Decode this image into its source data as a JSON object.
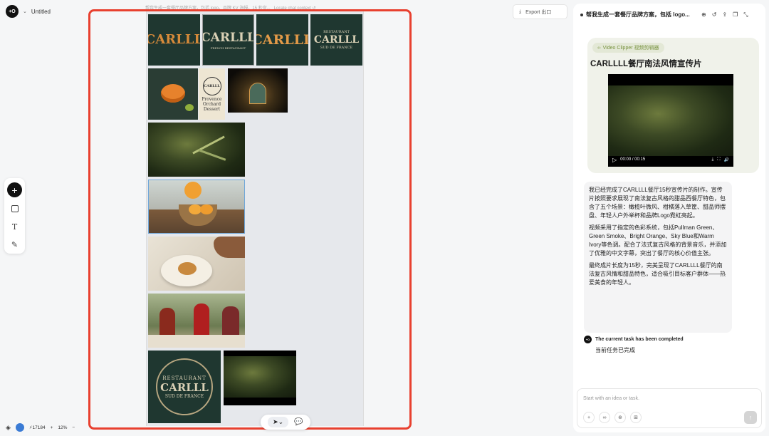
{
  "app": {
    "title": "Untitled",
    "logo": "+O"
  },
  "canvas": {
    "label": "帮我生成一套餐厅品牌方案，包括 logo、品牌 KV 海报、15 秒宣...",
    "context_label": "Locate chat context ↺",
    "export_label": "Export 出口",
    "brand_text": "CARLLL",
    "brand_small": "FRENCH RESTAURANT",
    "seal_top": "RESTAURANT",
    "seal_bottom": "SUD DE FRANCE",
    "poster_lines": [
      "Provence",
      "Orchard",
      "Dessert"
    ]
  },
  "toolbar": {
    "items": [
      "plus-icon",
      "square-icon",
      "text-icon",
      "pen-icon"
    ]
  },
  "status": {
    "credits": "17184",
    "zoom": "12%",
    "zoom_minus": "−",
    "zoom_plus": "+"
  },
  "panel": {
    "title": "帮我生成一套餐厅品牌方案，包括 logo...",
    "video_card": {
      "tag": "Video Clipper 视频剪辑器",
      "title": "CARLLLL餐厅南法风情宣传片",
      "time": "00:00 / 00:15"
    },
    "message": [
      "我已经完成了CARLLLL餐厅15秒宣传片的制作。宣传片按照要求展现了南法复古风格的甜品西餐厅特色，包含了五个场景：橄榄叶微风、柑橘落入草筐、甜品师摆盘、年轻人户外举杯和品牌Logo霓虹亮起。",
      "视频采用了指定的色彩系统，包括Pullman Green、Green Smoke、Bright Orange、Sky Blue和Warm Ivory等色调。配合了法式复古风格的背景音乐，并添加了优雅的中文字幕，突出了餐厅的核心价值主张。",
      "最终成片长度为15秒，完美呈现了CARLLLL餐厅的南法复古风情和甜品特色，适合吸引目标客户群体——热爱美食的年轻人。"
    ],
    "status_en": "The current task has been completed",
    "status_cn": "当前任务已完成",
    "input_placeholder": "Start with an idea or task."
  },
  "colors": {
    "accent_red": "#e8402f",
    "pullman_green": "#1f3730",
    "orange": "#d68a3a"
  }
}
